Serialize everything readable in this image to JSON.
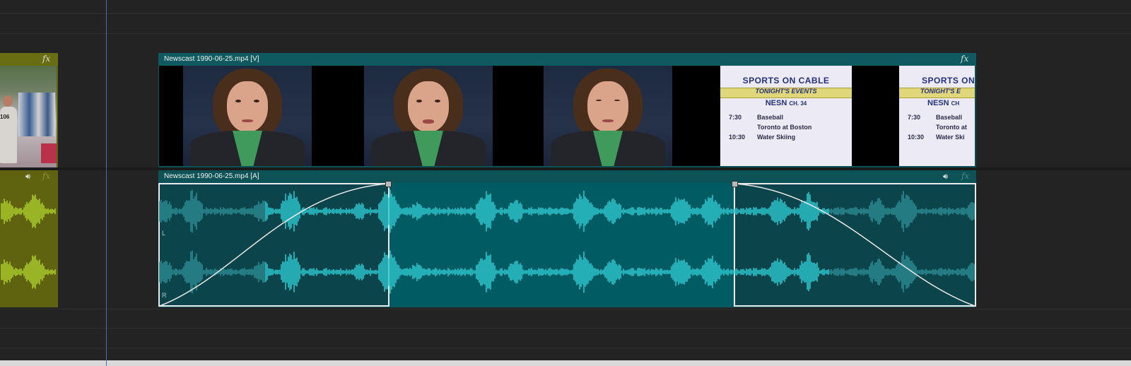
{
  "timeline": {
    "video_clip": {
      "name": "Newscast 1990-06-25.mp4 [V]",
      "fx_label": "fx"
    },
    "audio_clip": {
      "name": "Newscast 1990-06-25.mp4 [A]",
      "fx_label": "fx",
      "channels": [
        "L",
        "R"
      ]
    },
    "prev_clip": {
      "fx_label": "fx",
      "bib_number": "106"
    },
    "title_card": {
      "title": "SPORTS ON CABLE",
      "subtitle": "TONIGHT'S EVENTS",
      "network": "NESN",
      "channel": "CH. 34",
      "rows": [
        {
          "time": "7:30",
          "event": "Baseball"
        },
        {
          "time": "",
          "event": "Toronto at Boston"
        },
        {
          "time": "10:30",
          "event": "Water Skiing"
        }
      ]
    },
    "title_card_cropped": {
      "title": "SPORTS ON",
      "subtitle": "TONIGHT'S E",
      "network": "NESN",
      "channel": "CH",
      "rows": [
        {
          "time": "7:30",
          "event": "Baseball"
        },
        {
          "time": "",
          "event": "Toronto at"
        },
        {
          "time": "10:30",
          "event": "Water Ski"
        }
      ]
    },
    "icons": [
      "fx-icon",
      "speaker-icon",
      "keyframe-handle-icon"
    ],
    "colors": {
      "background": "#232323",
      "video_clip": "#0d5257",
      "audio_wave": "#2ec4cc",
      "prev_clip": "#5f6310",
      "prev_wave": "#a8c92a",
      "playhead": "#3f6fc4"
    }
  }
}
